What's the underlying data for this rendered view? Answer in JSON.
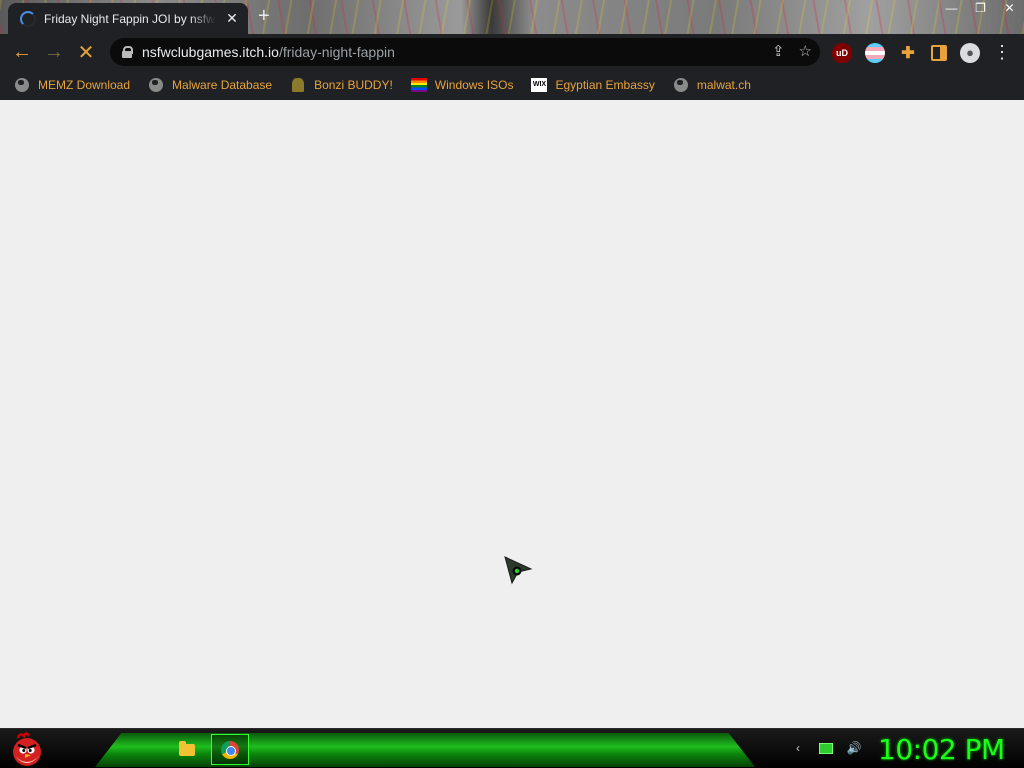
{
  "browser": {
    "tab": {
      "title": "Friday Night Fappin JOI by nsfwc"
    },
    "new_tab_symbol": "+",
    "window_controls": {
      "minimize": "—",
      "restore": "❐",
      "close": "✕"
    },
    "toolbar": {
      "back": "←",
      "forward": "→",
      "stop": "✕",
      "url_host": "nsfwclubgames.itch.io",
      "url_path": "/friday-night-fappin",
      "share_symbol": "⇪",
      "star_symbol": "☆",
      "menu_symbol": "⋮"
    },
    "extensions": {
      "ublock_label": "uD",
      "puzzle_symbol": "✚",
      "profile_symbol": "●"
    },
    "bookmarks": [
      {
        "label": "MEMZ Download",
        "icon": "globe-icon"
      },
      {
        "label": "Malware Database",
        "icon": "globe-icon"
      },
      {
        "label": "Bonzi BUDDY!",
        "icon": "bonzi-icon"
      },
      {
        "label": "Windows ISOs",
        "icon": "rainbow-flag-icon"
      },
      {
        "label": "Egyptian Embassy",
        "icon": "wix-icon"
      },
      {
        "label": "malwat.ch",
        "icon": "globe-icon"
      }
    ],
    "wix_icon_text": "WIX"
  },
  "taskbar": {
    "tray": {
      "chevron": "‹",
      "volume": "🔊"
    },
    "clock": "10:02 PM"
  },
  "colors": {
    "accent": "#e8a33d",
    "page_bg": "#efefef",
    "taskbar_green": "#1fbf1f",
    "clock": "#1aff1a"
  }
}
